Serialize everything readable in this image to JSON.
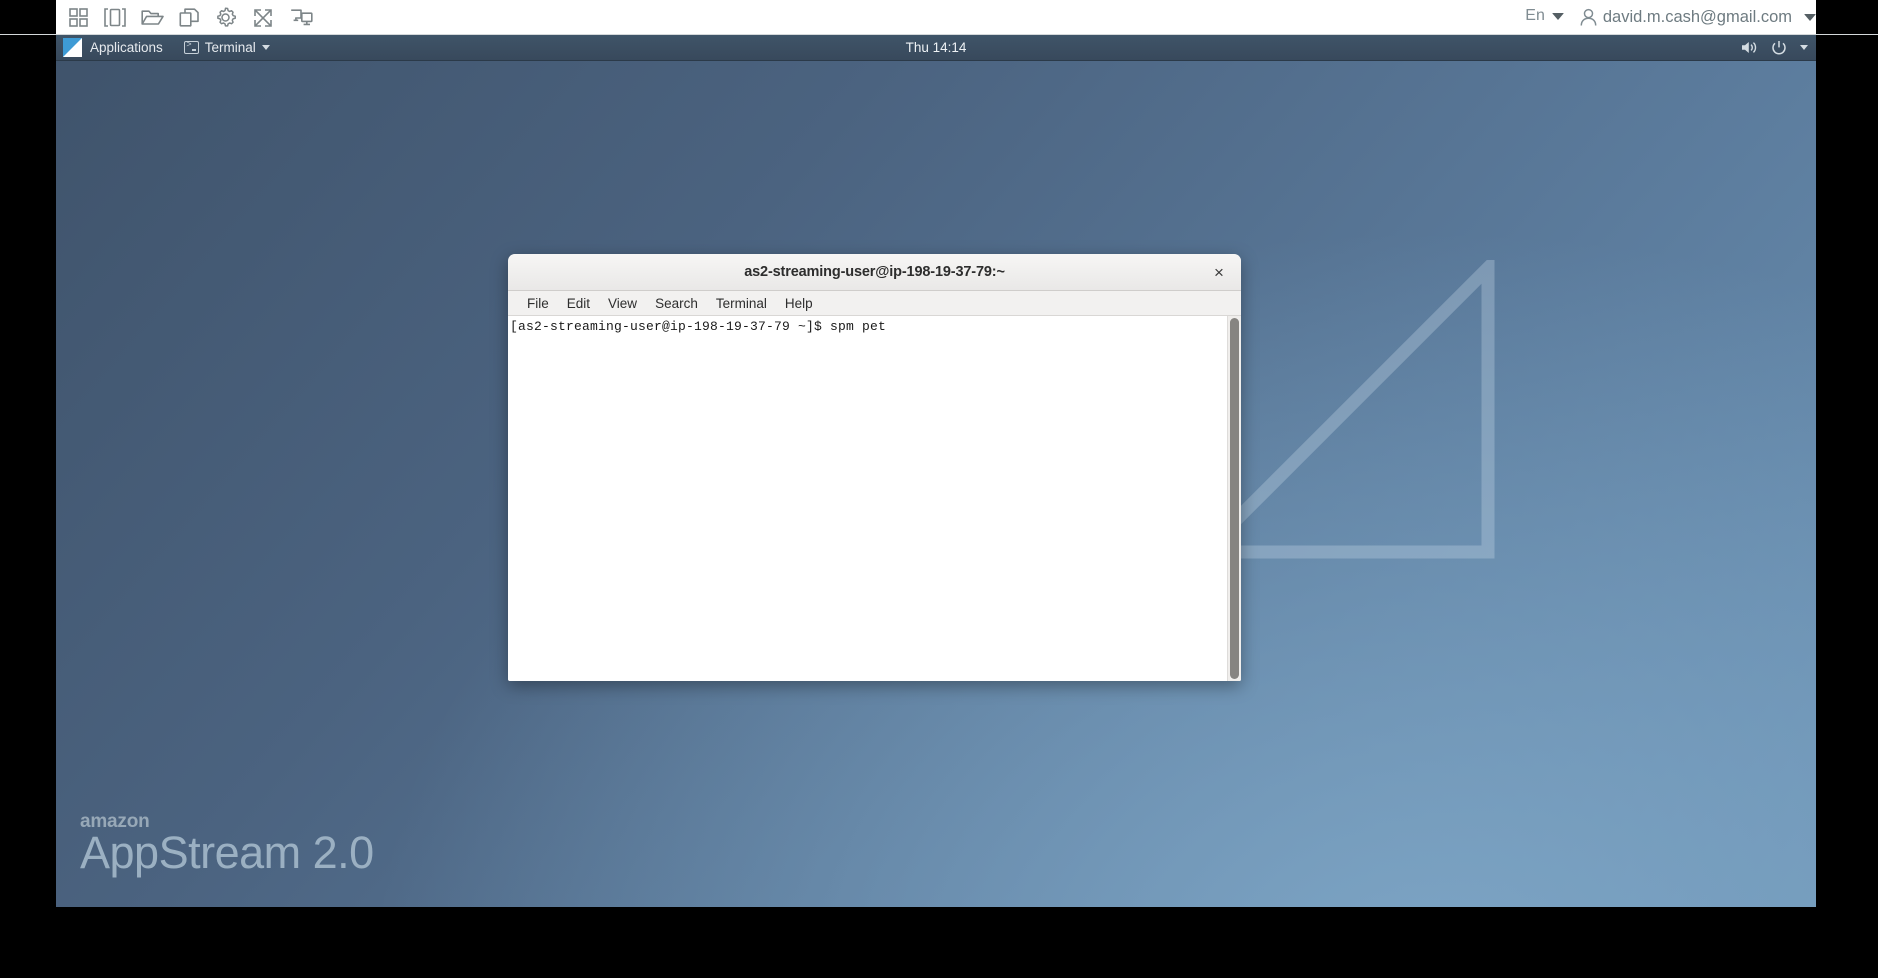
{
  "appstream_toolbar": {
    "icons": [
      {
        "name": "grid-apps-icon",
        "label": "Applications grid"
      },
      {
        "name": "window-switch-icon",
        "label": "Switch windows"
      },
      {
        "name": "folder-open-icon",
        "label": "My Files"
      },
      {
        "name": "copy-paste-icon",
        "label": "Clipboard"
      },
      {
        "name": "gear-icon",
        "label": "Settings"
      },
      {
        "name": "fullscreen-icon",
        "label": "Fullscreen"
      },
      {
        "name": "multi-monitor-icon",
        "label": "Displays"
      }
    ],
    "language": "En",
    "user_email": "david.m.cash@gmail.com"
  },
  "desktop": {
    "panel": {
      "applications_label": "Applications",
      "taskbar_item_label": "Terminal",
      "clock": "Thu 14:14"
    },
    "branding": {
      "vendor": "amazon",
      "product": "AppStream 2.0"
    }
  },
  "terminal": {
    "title": "as2-streaming-user@ip-198-19-37-79:~",
    "close_label": "×",
    "menus": [
      "File",
      "Edit",
      "View",
      "Search",
      "Terminal",
      "Help"
    ],
    "content": "[as2-streaming-user@ip-198-19-37-79 ~]$ spm pet"
  },
  "colors": {
    "toolbar_bg": "#ffffff",
    "panel_bg": "#3b4d61",
    "desktop_accent": "#6b92b4",
    "terminal_bg": "#ffffff",
    "titlebar_bg": "#eeeded"
  }
}
